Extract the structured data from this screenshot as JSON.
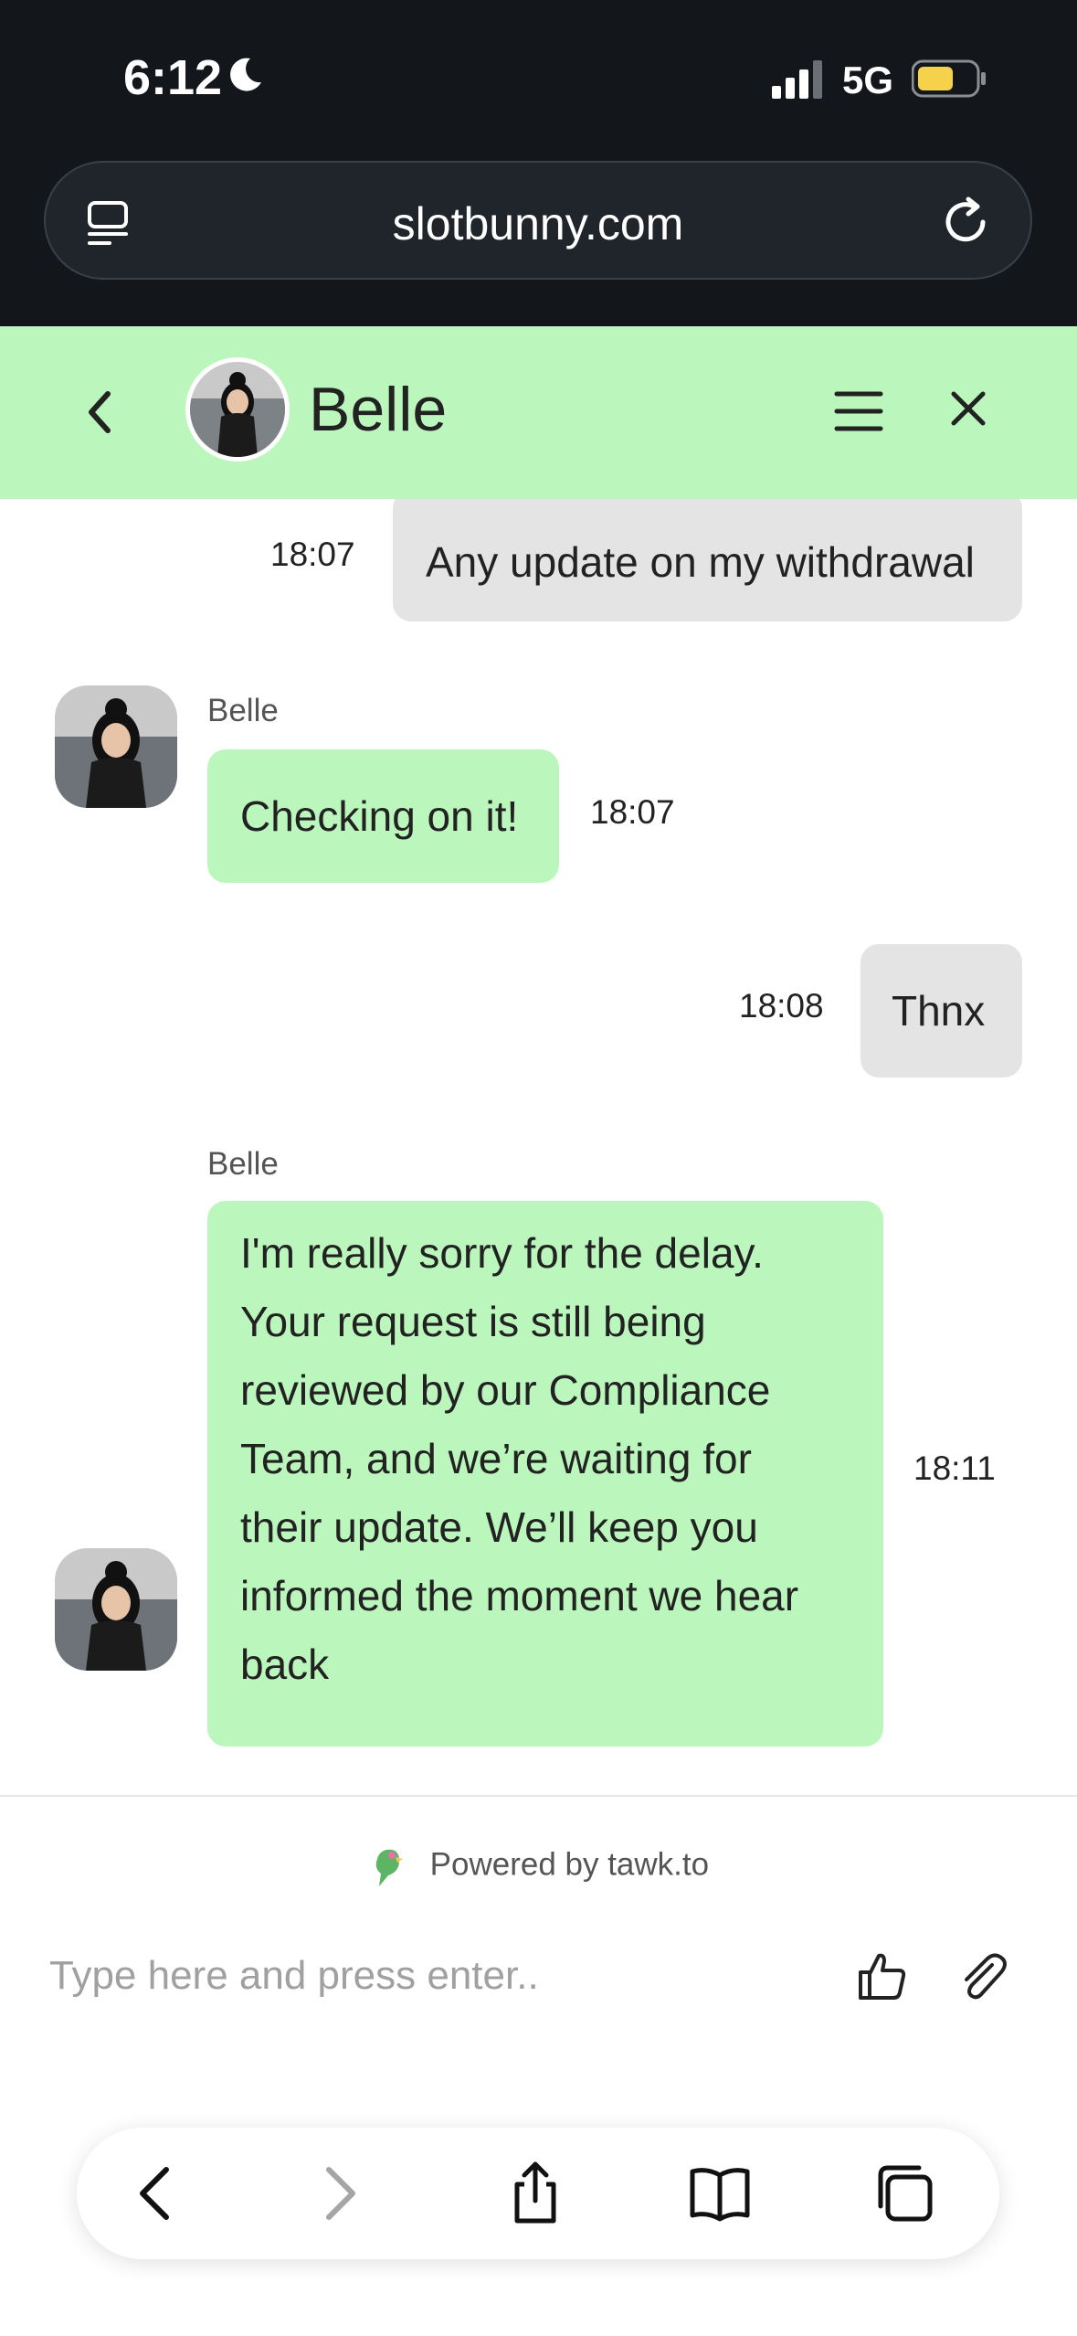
{
  "status_bar": {
    "time": "6:12",
    "network": "5G",
    "icons": [
      "moon-icon",
      "signal-icon",
      "battery-icon"
    ],
    "battery_color": "#f5d24a"
  },
  "browser": {
    "url": "slotbunny.com",
    "icons": [
      "tabs-menu-icon",
      "reload-icon"
    ]
  },
  "chat_header": {
    "agent_name": "Belle",
    "background": "#bbf7bc",
    "icons": [
      "back-icon",
      "menu-icon",
      "close-icon"
    ]
  },
  "messages": [
    {
      "direction": "outgoing",
      "text": "Any update on my withdrawal",
      "time": "18:07"
    },
    {
      "direction": "incoming",
      "sender": "Belle",
      "text": "Checking on it!",
      "time": "18:07"
    },
    {
      "direction": "outgoing",
      "text": "Thnx",
      "time": "18:08"
    },
    {
      "direction": "incoming",
      "sender": "Belle",
      "lines": [
        "I'm really sorry for the delay.",
        "Your request is still being",
        "reviewed by our Compliance",
        "Team, and we’re waiting for",
        "their update. We’ll keep you",
        "informed the moment we hear",
        "back"
      ],
      "time": "18:11"
    }
  ],
  "footer": {
    "powered_by": "Powered by tawk.to",
    "input_placeholder": "Type here and press enter..",
    "icons": [
      "thumbs-up-icon",
      "paperclip-icon"
    ]
  },
  "safari_toolbar": {
    "icons": [
      "back-arrow-icon",
      "forward-arrow-icon",
      "share-icon",
      "bookmarks-icon",
      "tabs-icon"
    ]
  },
  "colors": {
    "incoming_bubble": "#bbf7bc",
    "outgoing_bubble": "#e4e4e4",
    "top_bar": "#13161b"
  }
}
